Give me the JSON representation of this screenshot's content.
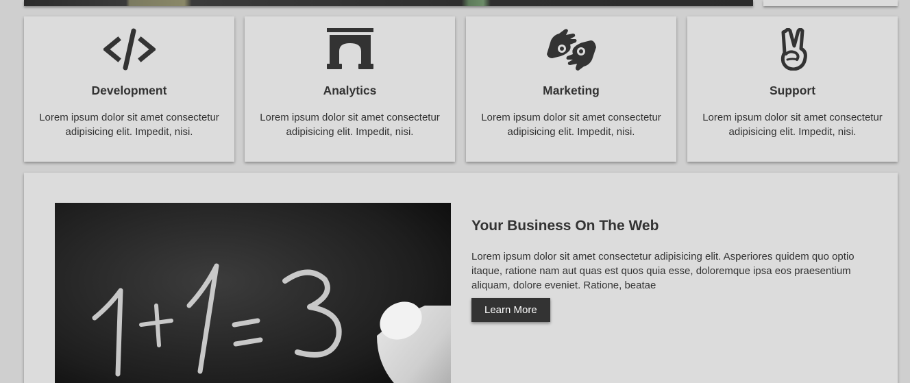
{
  "services": [
    {
      "icon": "code-icon",
      "title": "Development",
      "text": "Lorem ipsum dolor sit amet consectetur adipisicing elit. Impedit, nisi."
    },
    {
      "icon": "archway-icon",
      "title": "Analytics",
      "text": "Lorem ipsum dolor sit amet consectetur adipisicing elit. Impedit, nisi."
    },
    {
      "icon": "sign-language-icon",
      "title": "Marketing",
      "text": "Lorem ipsum dolor sit amet consectetur adipisicing elit. Impedit, nisi."
    },
    {
      "icon": "peace-hand-icon",
      "title": "Support",
      "text": "Lorem ipsum dolor sit amet consectetur adipisicing elit. Impedit, nisi."
    }
  ],
  "about": {
    "title": "Your Business On The Web",
    "text": "Lorem ipsum dolor sit amet consectetur adipisicing elit. Asperiores quidem quo optio itaque, ratione nam aut quas est quos quia esse, doloremque ipsa eos praesentium aliquam, dolore eveniet. Ratione, beatae",
    "button_label": "Learn More",
    "image_alt_text": "1+1=3"
  },
  "colors": {
    "page_bg": "#cfcfcf",
    "card_bg": "#dcdcdc",
    "text": "#333333",
    "button_bg": "#333333",
    "button_text": "#ffffff"
  }
}
